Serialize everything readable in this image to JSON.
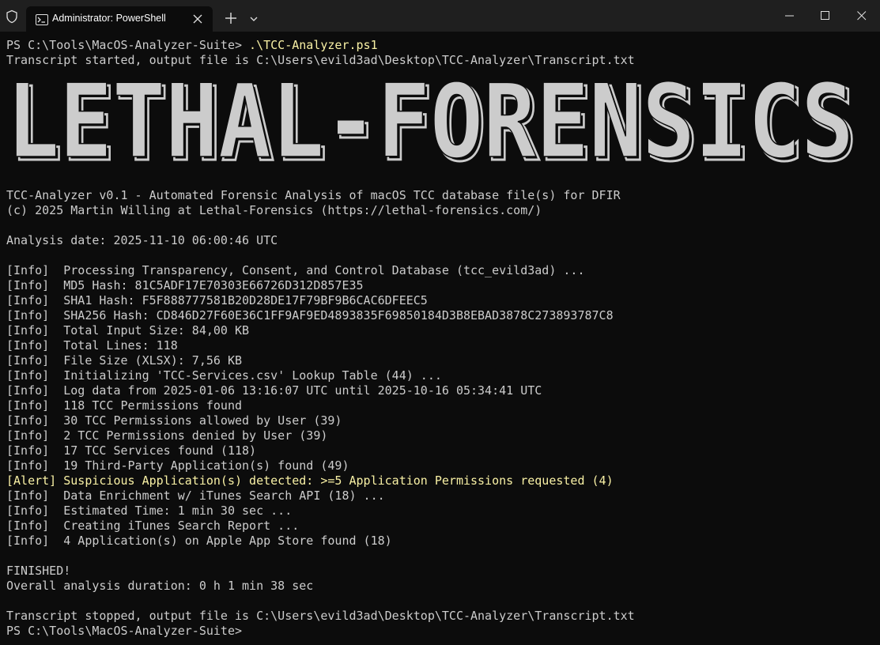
{
  "window": {
    "tab_title": "Administrator: PowerShell",
    "icons": {
      "shield": "shield-icon",
      "tab": "powershell-icon",
      "close_tab": "close-icon",
      "new_tab": "plus-icon",
      "dropdown": "chevron-down-icon",
      "minimize": "minimize-icon",
      "maximize": "maximize-icon",
      "close": "close-icon"
    }
  },
  "colors": {
    "background": "#0c0c0c",
    "titlebar": "#1f1f1f",
    "text": "#cccccc",
    "highlight": "#f9f1a5"
  },
  "terminal": {
    "prompt1": "PS C:\\Tools\\MacOS-Analyzer-Suite> ",
    "command": ".\\TCC-Analyzer.ps1",
    "transcript_start": "Transcript started, output file is C:\\Users\\evild3ad\\Desktop\\TCC-Analyzer\\Transcript.txt",
    "banner": "LETHAL-FORENSICS",
    "about1": "TCC-Analyzer v0.1 - Automated Forensic Analysis of macOS TCC database file(s) for DFIR",
    "about2": "(c) 2025 Martin Willing at Lethal-Forensics (https://lethal-forensics.com/)",
    "analysis_date": "Analysis date: 2025-11-10 06:00:46 UTC",
    "log": [
      "[Info]  Processing Transparency, Consent, and Control Database (tcc_evild3ad) ...",
      "[Info]  MD5 Hash: 81C5ADF17E70303E66726D312D857E35",
      "[Info]  SHA1 Hash: F5F888777581B20D28DE17F79BF9B6CAC6DFEEC5",
      "[Info]  SHA256 Hash: CD846D27F60E36C1FF9AF9ED4893835F69850184D3B8EBAD3878C273893787C8",
      "[Info]  Total Input Size: 84,00 KB",
      "[Info]  Total Lines: 118",
      "[Info]  File Size (XLSX): 7,56 KB",
      "[Info]  Initializing 'TCC-Services.csv' Lookup Table (44) ...",
      "[Info]  Log data from 2025-01-06 13:16:07 UTC until 2025-10-16 05:34:41 UTC",
      "[Info]  118 TCC Permissions found",
      "[Info]  30 TCC Permissions allowed by User (39)",
      "[Info]  2 TCC Permissions denied by User (39)",
      "[Info]  17 TCC Services found (118)",
      "[Info]  19 Third-Party Application(s) found (49)",
      "[Alert] Suspicious Application(s) detected: >=5 Application Permissions requested (4)",
      "[Info]  Data Enrichment w/ iTunes Search API (18) ...",
      "[Info]  Estimated Time: 1 min 30 sec ...",
      "[Info]  Creating iTunes Search Report ...",
      "[Info]  4 Application(s) on Apple App Store found (18)"
    ],
    "finished": "FINISHED!",
    "duration": "Overall analysis duration: 0 h 1 min 38 sec",
    "transcript_stop": "Transcript stopped, output file is C:\\Users\\evild3ad\\Desktop\\TCC-Analyzer\\Transcript.txt",
    "prompt2": "PS C:\\Tools\\MacOS-Analyzer-Suite>"
  }
}
